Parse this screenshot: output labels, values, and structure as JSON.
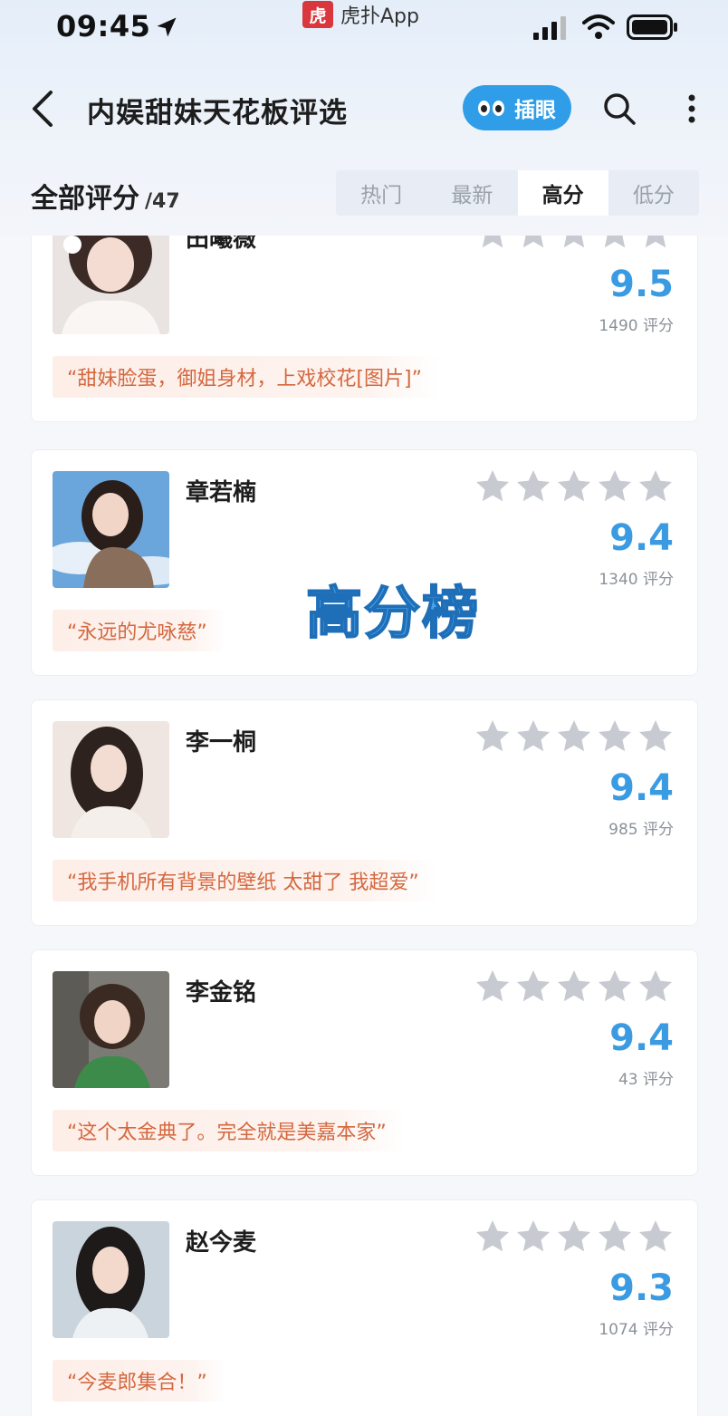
{
  "status_bar": {
    "time": "09:45",
    "source_app_logo": "虎",
    "source_app_name": "虎扑App"
  },
  "nav": {
    "title": "内娱甜妹天花板评选",
    "peek_button": "插眼",
    "icons": [
      "back-chevron-icon",
      "eyes-icon",
      "search-icon",
      "more-vertical-icon"
    ]
  },
  "section": {
    "title": "全部评分",
    "count": "/47",
    "tabs": [
      {
        "label": "热门",
        "active": false
      },
      {
        "label": "最新",
        "active": false
      },
      {
        "label": "高分",
        "active": true
      },
      {
        "label": "低分",
        "active": false
      }
    ]
  },
  "overlay_text": "高分榜",
  "colors": {
    "accent": "#3b9be2",
    "star": "#c7cad1",
    "quote_text": "#d4683f",
    "quote_bg": "#fdeee8"
  },
  "cards": [
    {
      "name": "田曦薇",
      "stars": 5,
      "score": "9.5",
      "votes": "1490 评分",
      "quote": "“甜妹脸蛋，御姐身材，上戏校花[图片]”"
    },
    {
      "name": "章若楠",
      "stars": 5,
      "score": "9.4",
      "votes": "1340 评分",
      "quote": "“永远的尤咏慈”"
    },
    {
      "name": "李一桐",
      "stars": 5,
      "score": "9.4",
      "votes": "985 评分",
      "quote": "“我手机所有背景的壁纸  太甜了  我超爱”"
    },
    {
      "name": "李金铭",
      "stars": 5,
      "score": "9.4",
      "votes": "43 评分",
      "quote": "“这个太金典了。完全就是美嘉本家”"
    },
    {
      "name": "赵今麦",
      "stars": 5,
      "score": "9.3",
      "votes": "1074 评分",
      "quote": "“今麦郎集合！”"
    }
  ]
}
